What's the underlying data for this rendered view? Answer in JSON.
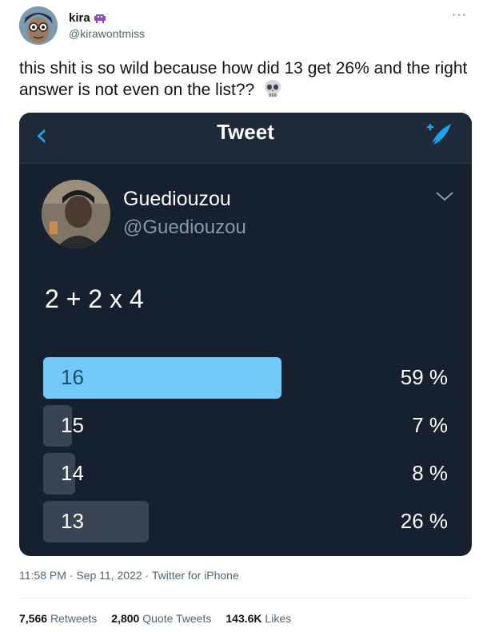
{
  "author": {
    "name": "kira",
    "name_emoji": "alien-monster-emoji",
    "handle": "@kirawontmiss",
    "more_icon": "more-dots-icon"
  },
  "tweet": {
    "text": "this shit is so wild because how did 13 get 26% and the right answer is not even on the list??",
    "emoji": "skull-emoji"
  },
  "media": {
    "header_title": "Tweet",
    "back_icon": "chevron-left-icon",
    "compose_icon": "compose-tweet-icon",
    "original_author": {
      "name": "Guediouzou",
      "handle": "@Guediouzou",
      "menu_icon": "chevron-down-icon"
    },
    "question": "2 + 2 x 4",
    "poll": [
      {
        "label": "16",
        "percent_text": "59 %",
        "percent": 59
      },
      {
        "label": "15",
        "percent_text": "7 %",
        "percent": 7
      },
      {
        "label": "14",
        "percent_text": "8 %",
        "percent": 8
      },
      {
        "label": "13",
        "percent_text": "26 %",
        "percent": 26
      }
    ],
    "colors": {
      "background": "#17202e",
      "accent": "#1da1f2",
      "leading_bar": "#71c9f8",
      "bar": "#3a4553"
    }
  },
  "meta": {
    "time": "11:58 PM",
    "separator": "·",
    "date": "Sep 11, 2022",
    "source": "Twitter for iPhone"
  },
  "stats": {
    "retweets_count": "7,566",
    "retweets_label": "Retweets",
    "quotes_count": "2,800",
    "quotes_label": "Quote Tweets",
    "likes_count": "143.6K",
    "likes_label": "Likes"
  }
}
